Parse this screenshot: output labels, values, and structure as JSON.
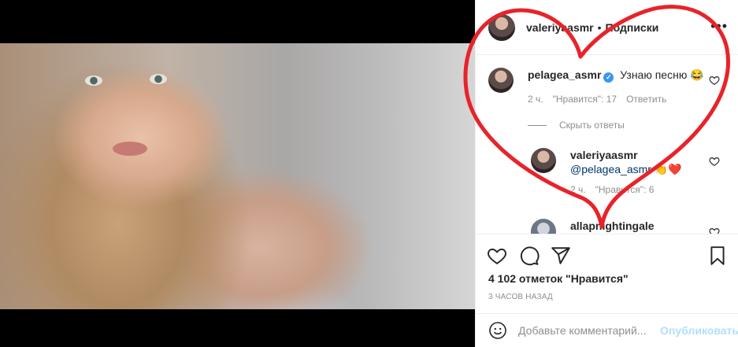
{
  "post_header": {
    "username": "valeriyaasmr",
    "separator": "•",
    "follow_label": "Подписки",
    "more_icon": "more-horizontal-icon"
  },
  "comments": [
    {
      "author": "pelagea_asmr",
      "verified": true,
      "text": "Узнаю песню 😂",
      "time": "2 ч.",
      "likes_label": "\"Нравится\": 17",
      "reply_label": "Ответить"
    },
    {
      "author": "valeriyaasmr",
      "mention": "@pelagea_asmr",
      "text": "👏❤️",
      "time": "2 ч.",
      "likes_label": "\"Нравится\": 6"
    },
    {
      "author": "allapnightingale"
    }
  ],
  "hide_replies_label": "Скрыть ответы",
  "actions": {
    "like_icon": "heart-icon",
    "comment_icon": "comment-icon",
    "share_icon": "send-icon",
    "save_icon": "bookmark-icon"
  },
  "likes_text": "4 102 отметок \"Нравится\"",
  "timestamp": "3 ЧАСОВ НАЗАД",
  "add_comment": {
    "placeholder": "Добавьте комментарий...",
    "publish_label": "Опубликовать",
    "emoji_icon": "smile-icon"
  },
  "colors": {
    "annotation_red": "#e8232a",
    "verified_blue": "#3897f0",
    "publish_disabled": "#b2dffc"
  }
}
